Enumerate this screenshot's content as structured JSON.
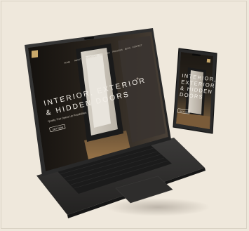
{
  "laptop": {
    "nav": [
      "HOME",
      "ABOUT",
      "PORTFOLIO",
      "SERVICES",
      "PROCESS",
      "BLOG",
      "CONTACT"
    ],
    "headline": [
      "INTERIOR, EXTERIOR",
      "& HIDDEN DOORS"
    ],
    "subhead": "Quality That Opens Up Possibilities",
    "cta": "GET NOW"
  },
  "phone": {
    "headline": [
      "INTERIOR,",
      "EXTERIOR",
      "& HIDDEN",
      "DOORS"
    ],
    "cta": "GET NOW"
  },
  "colors": {
    "background": "#efe8dc",
    "device_body": "#2b2b2b",
    "screen_dark": "#1a1714",
    "door_wood": "#8a6a44",
    "accent_gold": "#c9a86a"
  }
}
